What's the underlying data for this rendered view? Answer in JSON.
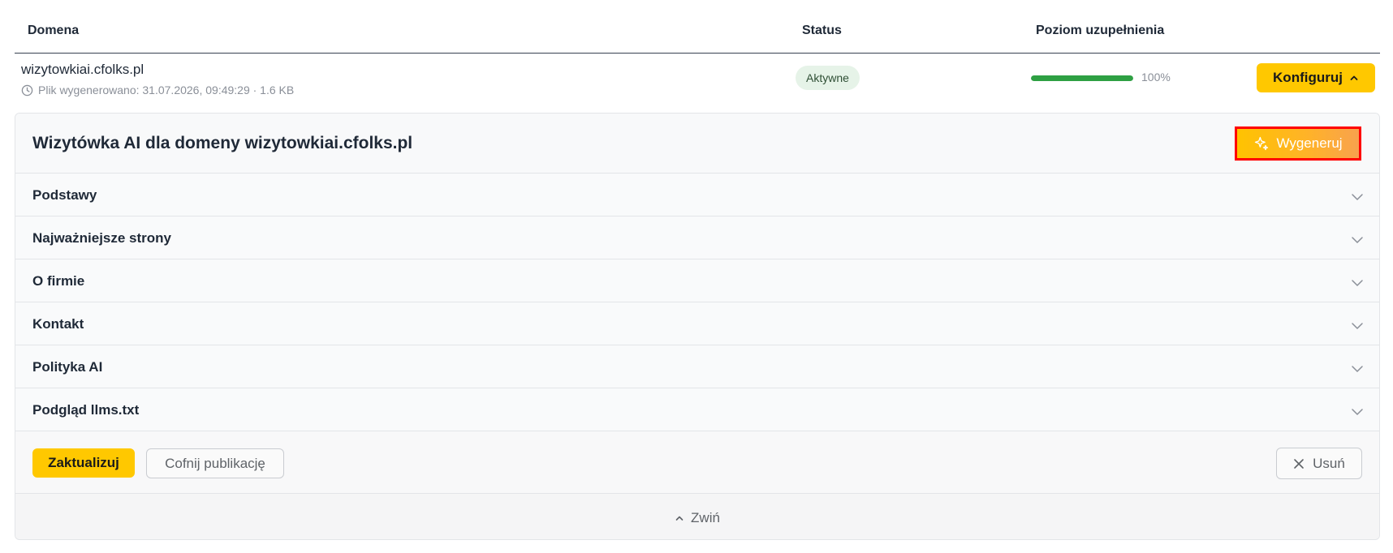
{
  "table": {
    "headers": {
      "domain": "Domena",
      "status": "Status",
      "level": "Poziom uzupełnienia"
    },
    "row": {
      "domain": "wizytowkiai.cfolks.pl",
      "meta": "Plik wygenerowano: 31.07.2026, 09:49:29 · 1.6 KB",
      "status": "Aktywne",
      "progress_value": 100,
      "progress_label": "100%",
      "configure_label": "Konfiguruj"
    }
  },
  "panel": {
    "title": "Wizytówka AI dla domeny wizytowkiai.cfolks.pl",
    "generate_label": "Wygeneruj",
    "sections": [
      {
        "label": "Podstawy"
      },
      {
        "label": "Najważniejsze strony"
      },
      {
        "label": "O firmie"
      },
      {
        "label": "Kontakt"
      },
      {
        "label": "Polityka AI"
      },
      {
        "label": "Podgląd llms.txt"
      }
    ],
    "actions": {
      "update_label": "Zaktualizuj",
      "unpublish_label": "Cofnij publikację",
      "delete_label": "Usuń"
    },
    "collapse_label": "Zwiń"
  },
  "colors": {
    "accent": "#ffc800",
    "progress": "#2ea043",
    "status_bg": "#e6f3e8",
    "highlight_border": "#ff0000"
  },
  "icons": {
    "meta": "clock-icon",
    "configure": "chevron-up-icon",
    "generate": "sparkle-icon",
    "section": "chevron-down-icon",
    "delete": "close-icon",
    "collapse": "chevron-up-icon"
  }
}
